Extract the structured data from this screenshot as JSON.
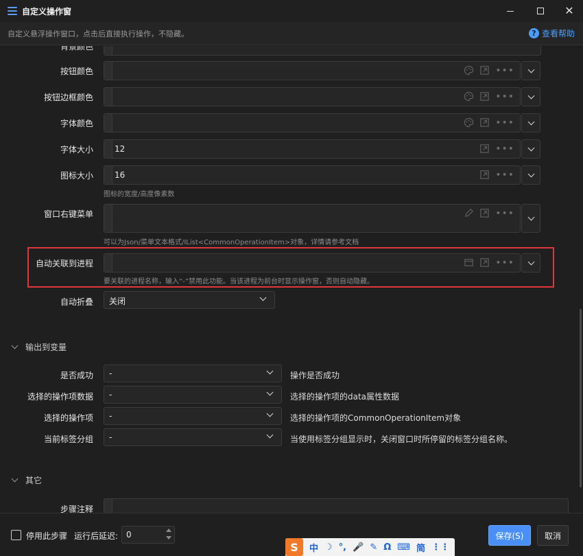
{
  "window": {
    "title": "自定义操作窗",
    "description": "自定义悬浮操作窗口，点击后直接执行操作，不隐藏。",
    "help_label": "查看帮助",
    "help_icon_char": "?",
    "close_char": "✕"
  },
  "fields": {
    "bg_color": {
      "label": "背景颜色"
    },
    "button_color": {
      "label": "按钮颜色",
      "value": ""
    },
    "button_border_color": {
      "label": "按钮边框颜色",
      "value": ""
    },
    "font_color": {
      "label": "字体颜色",
      "value": ""
    },
    "font_size": {
      "label": "字体大小",
      "value": "12"
    },
    "icon_size": {
      "label": "图标大小",
      "value": "16",
      "hint": "图标的宽度/高度像素数"
    },
    "context_menu": {
      "label": "窗口右键菜单",
      "value": "",
      "hint": "可以为Json/菜单文本格式/IList<CommonOperationItem>对象，详情请参考文档"
    },
    "auto_process": {
      "label": "自动关联到进程",
      "value": "",
      "hint": "要关联的进程名称，输入“-”禁用此功能。当该进程为前台时显示操作窗，否则自动隐藏。"
    },
    "auto_collapse": {
      "label": "自动折叠",
      "value": "关闭"
    }
  },
  "sections": {
    "output": {
      "title": "输出到变量"
    },
    "other": {
      "title": "其它"
    }
  },
  "outputs": [
    {
      "label": "是否成功",
      "value": "-",
      "desc": "操作是否成功"
    },
    {
      "label": "选择的操作项数据",
      "value": "-",
      "desc": "选择的操作项的data属性数据"
    },
    {
      "label": "选择的操作项",
      "value": "-",
      "desc": "选择的操作项的CommonOperationItem对象"
    },
    {
      "label": "当前标签分组",
      "value": "-",
      "desc": "当使用标签分组显示时，关闭窗口时所停留的标签分组名称。"
    }
  ],
  "other": {
    "step_note_label": "步骤注释",
    "step_note_value": ""
  },
  "footer": {
    "disable_step_label": "停用此步骤",
    "delay_label": "运行后延迟:",
    "delay_value": "0",
    "save_label": "保存(S)",
    "cancel_label": "取消"
  },
  "ime": {
    "logo": "S",
    "items": [
      "中",
      "☽",
      "°,",
      "🎤",
      "✎",
      "Ω",
      "⌨",
      "简",
      "⋮⋮"
    ]
  },
  "colors": {
    "accent": "#4a8ff5",
    "highlight_border": "#e0373c",
    "help_link": "#4a9eff"
  }
}
